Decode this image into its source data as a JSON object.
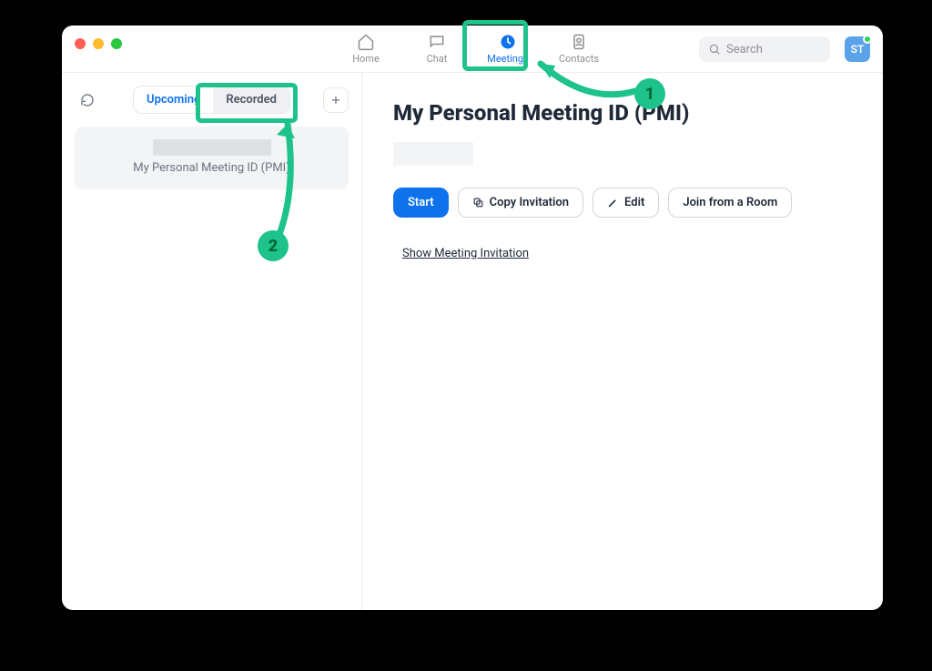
{
  "nav": {
    "home": "Home",
    "chat": "Chat",
    "meetings": "Meetings",
    "contacts": "Contacts"
  },
  "search": {
    "placeholder": "Search"
  },
  "avatar": {
    "initials": "ST"
  },
  "sidebar": {
    "upcoming": "Upcoming",
    "recorded": "Recorded",
    "card_title": "My Personal Meeting ID (PMI)"
  },
  "detail": {
    "title": "My Personal Meeting ID (PMI)",
    "start": "Start",
    "copy": "Copy Invitation",
    "edit": "Edit",
    "join_room": "Join from a Room",
    "show_invite": "Show Meeting Invitation"
  },
  "annotations": {
    "one": "1",
    "two": "2"
  }
}
